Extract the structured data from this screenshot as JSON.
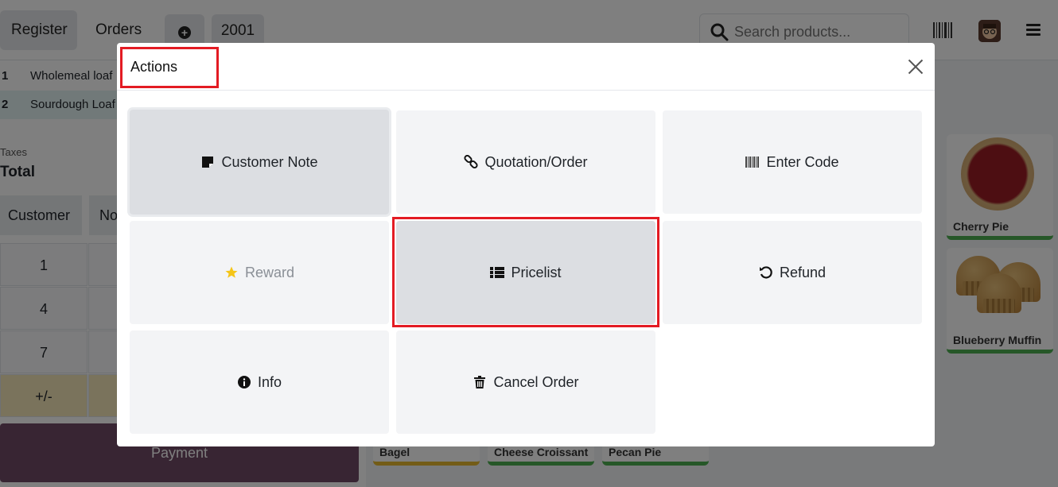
{
  "topbar": {
    "tabs": [
      {
        "label": "Register"
      },
      {
        "label": "Orders"
      }
    ],
    "order_number": "2001",
    "search": {
      "placeholder": "Search products..."
    }
  },
  "order": {
    "lines": [
      {
        "qty": "1",
        "name": "Wholemeal loaf"
      },
      {
        "qty": "2",
        "name": "Sourdough Loaf"
      }
    ],
    "taxes_label": "Taxes",
    "total_label": "Total"
  },
  "controls": {
    "customer_label": "Customer",
    "note_label": "No",
    "numpad": [
      "1",
      "4",
      "7",
      "+/-"
    ],
    "payment_label": "Payment"
  },
  "products": {
    "cards": [
      {
        "name": "Cherry Pie"
      },
      {
        "name": "Blueberry Muffin"
      },
      {
        "name": "Bagel"
      },
      {
        "name": "Cheese Croissant"
      },
      {
        "name": "Pecan Pie"
      }
    ]
  },
  "modal": {
    "title": "Actions",
    "actions": [
      {
        "label": "Customer Note",
        "icon": "note-icon"
      },
      {
        "label": "Quotation/Order",
        "icon": "link-icon"
      },
      {
        "label": "Enter Code",
        "icon": "barcode-icon"
      },
      {
        "label": "Reward",
        "icon": "star-icon"
      },
      {
        "label": "Pricelist",
        "icon": "list-icon"
      },
      {
        "label": "Refund",
        "icon": "undo-icon"
      },
      {
        "label": "Info",
        "icon": "info-icon"
      },
      {
        "label": "Cancel Order",
        "icon": "trash-icon"
      }
    ]
  },
  "colors": {
    "highlight": "#e31b23",
    "payment": "#714b67",
    "star": "#f5c518"
  }
}
